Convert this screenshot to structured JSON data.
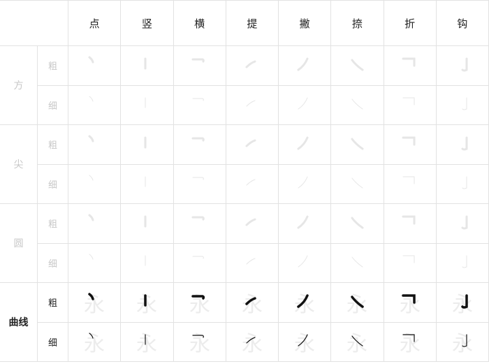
{
  "stroke_types": [
    "点",
    "竖",
    "横",
    "提",
    "撇",
    "捺",
    "折",
    "钩"
  ],
  "groups": [
    {
      "label": "方",
      "active": false
    },
    {
      "label": "尖",
      "active": false
    },
    {
      "label": "圆",
      "active": false
    },
    {
      "label": "曲线",
      "active": true
    }
  ],
  "weights": [
    "粗",
    "细"
  ],
  "ghost_char": "永",
  "colors": {
    "grid_line": "#e2e2e2",
    "inactive_text": "#c8c8c8",
    "active_text": "#222222",
    "active_stroke": "#111111"
  }
}
